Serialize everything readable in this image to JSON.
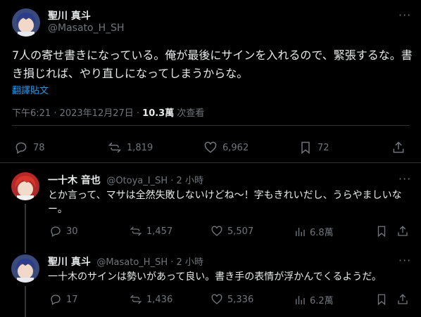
{
  "main": {
    "author_name": "聖川 真斗",
    "author_handle": "@Masato_H_SH",
    "text": "7人の寄せ書きになっている。俺が最後にサインを入れるので、緊張するな。書き損じれば、やり直しになってしまうからな。",
    "translate_label": "翻譯貼文",
    "time": "下午6:21 · 2023年12月27日 · ",
    "views": "10.3萬",
    "views_label": " 次查看",
    "replies": "78",
    "reposts": "1,819",
    "likes": "6,962",
    "bookmarks": "72",
    "more_label": "···"
  },
  "replies": [
    {
      "author_name": "一十木 音也",
      "author_handle": "@Otoya_I_SH",
      "time": " · 2 小時",
      "text": "とか言って、マサは全然失敗しないけどね～！字もきれいだし、うらやましいなー。",
      "replies": "30",
      "reposts": "1,457",
      "likes": "5,507",
      "views": "6.8萬"
    },
    {
      "author_name": "聖川 真斗",
      "author_handle": "@Masato_H_SH",
      "time": " · 2 小時",
      "text": "一十木のサインは勢いがあって良い。書き手の表情が浮かんでくるようだ。",
      "replies": "17",
      "reposts": "1,436",
      "likes": "5,336",
      "views": "6.2萬"
    }
  ],
  "colors": {
    "background": "#000000",
    "text": "#e7e9ea",
    "muted": "#71767b",
    "link": "#1d9bf0",
    "divider": "#2f3336"
  }
}
